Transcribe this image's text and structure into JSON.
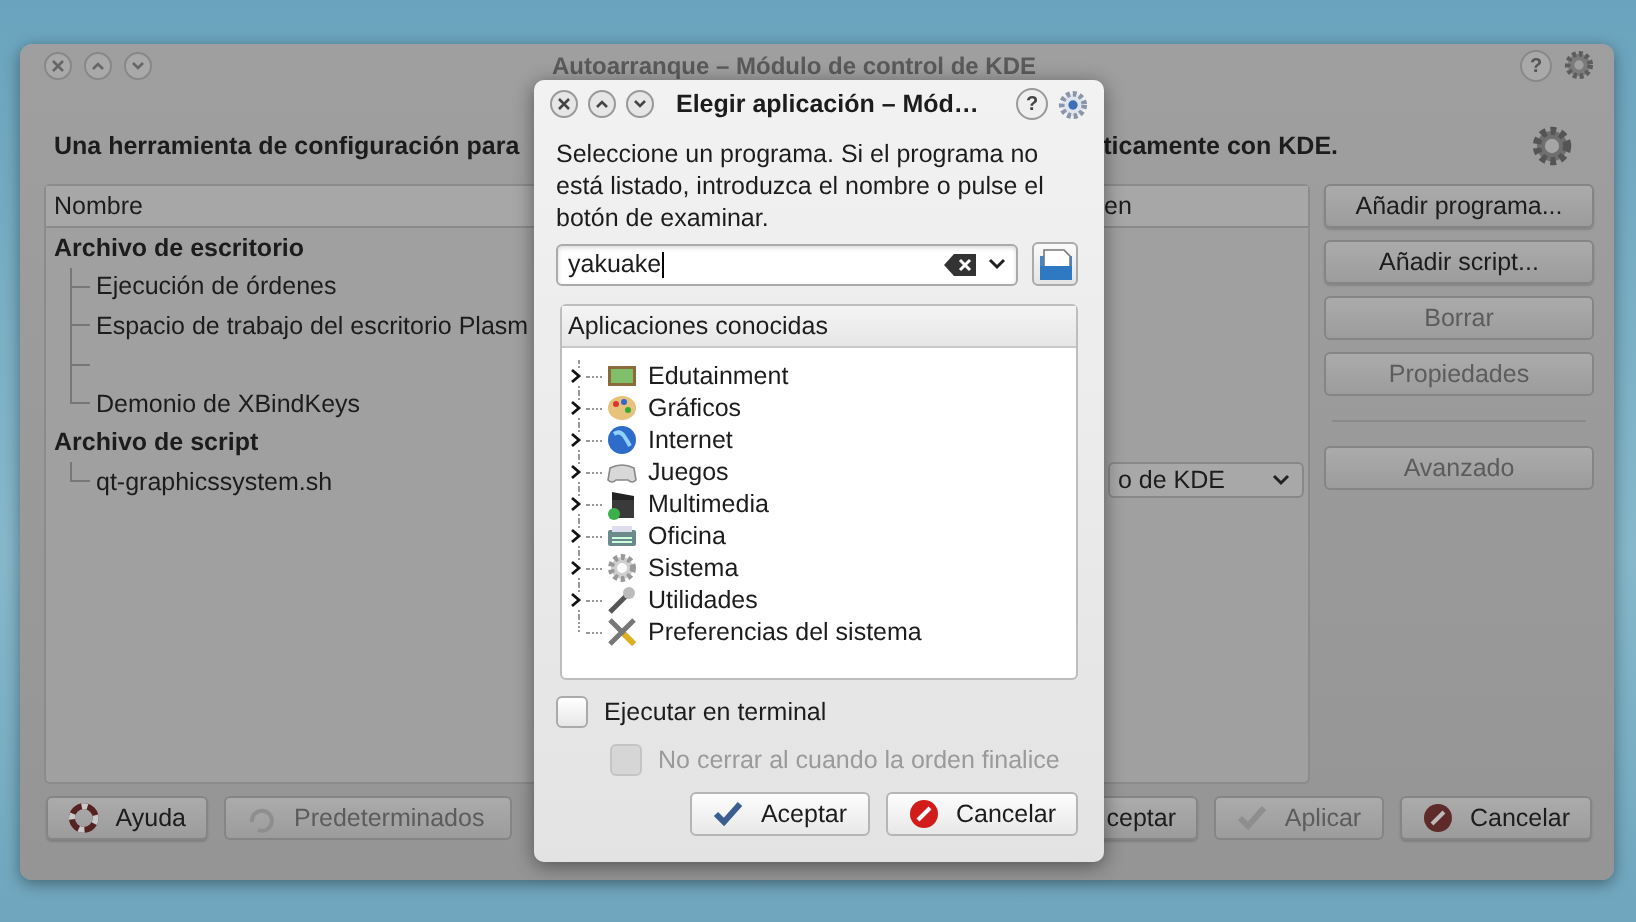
{
  "background_window": {
    "title": "Autoarranque – Módulo de control de KDE",
    "help_glyph": "?",
    "description_start": "Una herramienta de configuración para",
    "description_end": "ticamente con KDE.",
    "table": {
      "columns": [
        "Nombre",
        "en"
      ],
      "groups": [
        {
          "label": "Archivo de escritorio",
          "children": [
            {
              "kind": "text",
              "name": "Ejecución de órdenes"
            },
            {
              "kind": "text",
              "name": "Espacio de trabajo del escritorio Plasm"
            },
            {
              "kind": "blank"
            },
            {
              "kind": "text",
              "name": "Demonio de XBindKeys"
            }
          ]
        },
        {
          "label": "Archivo de script",
          "children": [
            {
              "kind": "text",
              "name": "qt-graphicssystem.sh",
              "combo": "o de KDE"
            }
          ]
        }
      ]
    },
    "side_buttons": [
      {
        "label": "Añadir programa...",
        "disabled": false
      },
      {
        "label": "Añadir script...",
        "disabled": false
      },
      {
        "label": "Borrar",
        "disabled": true
      },
      {
        "label": "Propiedades",
        "disabled": true
      },
      {
        "label": "Avanzado",
        "disabled": true
      }
    ],
    "bottom_buttons": [
      {
        "kind": "help",
        "label": "Ayuda",
        "disabled": false
      },
      {
        "kind": "defaults",
        "label": "Predeterminados",
        "disabled": true
      },
      {
        "kind": "accept",
        "label": "ceptar",
        "disabled": false
      },
      {
        "kind": "apply",
        "label": "Aplicar",
        "disabled": true
      },
      {
        "kind": "cancel",
        "label": "Cancelar",
        "disabled": false
      }
    ]
  },
  "dialog": {
    "title": "Elegir aplicación – Mód…",
    "help_glyph": "?",
    "instructions": "Seleccione un programa. Si el programa no está listado, introduzca el nombre o pulse el botón de examinar.",
    "search": {
      "value": "yakuake"
    },
    "list": {
      "header": "Aplicaciones conocidas",
      "items": [
        {
          "kind": "folder",
          "label": "Edutainment"
        },
        {
          "kind": "folder",
          "label": "Gráficos"
        },
        {
          "kind": "folder",
          "label": "Internet"
        },
        {
          "kind": "folder",
          "label": "Juegos"
        },
        {
          "kind": "folder",
          "label": "Multimedia"
        },
        {
          "kind": "folder",
          "label": "Oficina"
        },
        {
          "kind": "folder",
          "label": "Sistema"
        },
        {
          "kind": "folder",
          "label": "Utilidades"
        },
        {
          "kind": "leaf",
          "label": "Preferencias del sistema"
        }
      ]
    },
    "options": [
      {
        "label": "Ejecutar en terminal",
        "checked": false,
        "disabled": false
      },
      {
        "label": "No cerrar al cuando la orden finalice",
        "checked": false,
        "disabled": true
      }
    ],
    "buttons": [
      {
        "kind": "accept",
        "label": "Aceptar"
      },
      {
        "kind": "cancel",
        "label": "Cancelar"
      }
    ]
  }
}
